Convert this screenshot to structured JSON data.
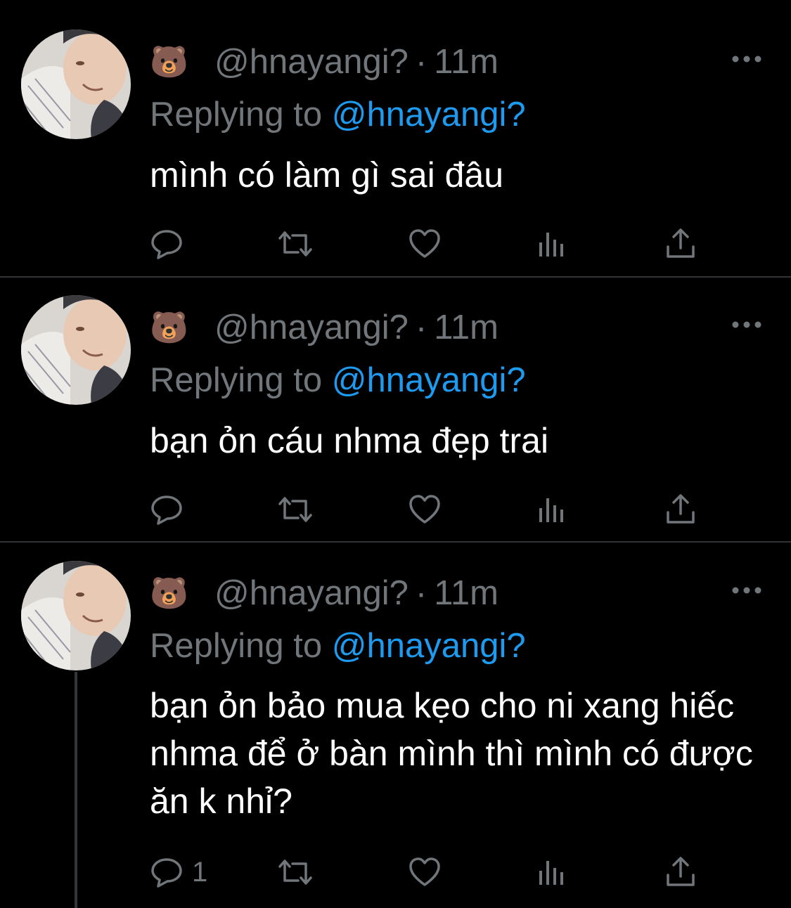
{
  "tweets": [
    {
      "author_emoji": "🐻",
      "handle": "@hnayangi?",
      "separator": "·",
      "time": "11m",
      "replying_prefix": "Replying to",
      "replying_to": "@hnayangi?",
      "text": "mình có làm gì sai đâu",
      "reply_count": ""
    },
    {
      "author_emoji": "🐻",
      "handle": "@hnayangi?",
      "separator": "·",
      "time": "11m",
      "replying_prefix": "Replying to",
      "replying_to": "@hnayangi?",
      "text": "bạn ỏn cáu nhma đẹp trai",
      "reply_count": ""
    },
    {
      "author_emoji": "🐻",
      "handle": "@hnayangi?",
      "separator": "·",
      "time": "11m",
      "replying_prefix": "Replying to",
      "replying_to": "@hnayangi?",
      "text": "bạn ỏn bảo mua kẹo cho ni xang hiếc nhma để ở bàn mình thì mình có được ăn k nhỉ?",
      "reply_count": "1"
    }
  ],
  "colors": {
    "background": "#000000",
    "secondary_text": "#71767b",
    "mention": "#1d9bf0",
    "primary_text": "#ffffff",
    "divider": "#2f3336"
  },
  "icons": [
    "reply-icon",
    "retweet-icon",
    "like-icon",
    "views-icon",
    "share-icon",
    "more-icon"
  ]
}
